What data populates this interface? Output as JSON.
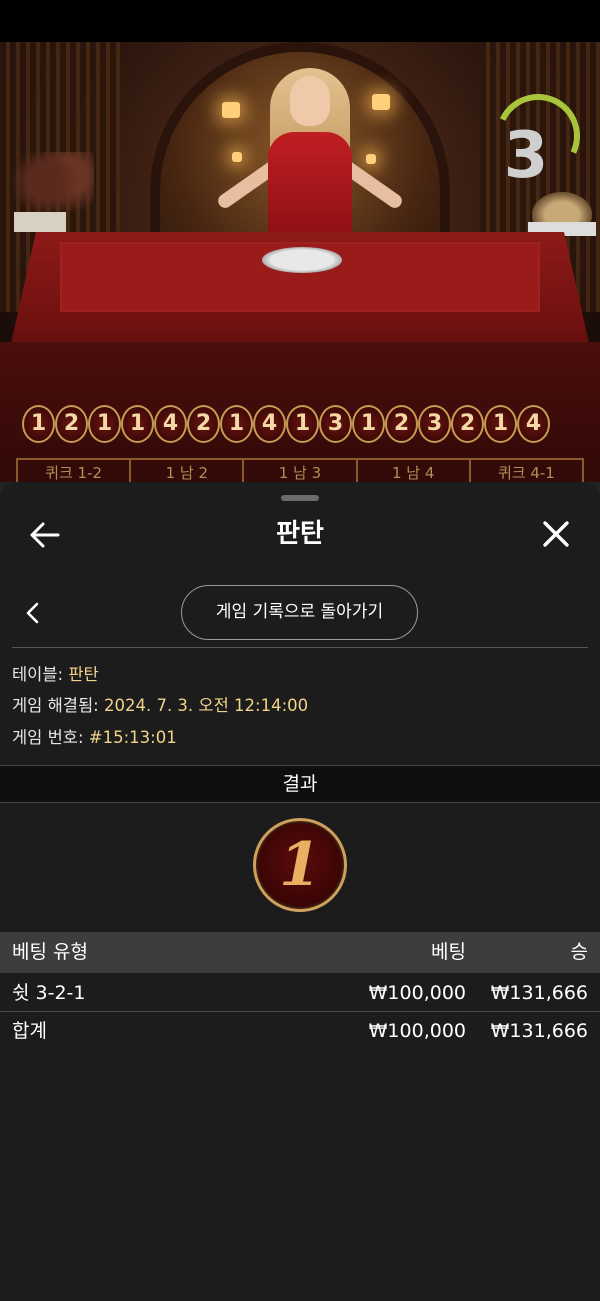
{
  "roadmap": {
    "beads": [
      "1",
      "2",
      "1",
      "1",
      "4",
      "2",
      "1",
      "4",
      "1",
      "3",
      "1",
      "2",
      "3",
      "2",
      "1",
      "4"
    ],
    "betting_labels": [
      "퀴크 1-2",
      "1 남 2",
      "1 남 3",
      "1 남 4",
      "퀴크 4-1"
    ]
  },
  "countdown": "3",
  "sheet": {
    "title": "판탄",
    "back_to_history_label": "게임 기록으로 돌아가기",
    "info": {
      "table_label": "테이블:",
      "table_value": "판탄",
      "resolved_label": "게임 해결됨:",
      "resolved_value": "2024. 7. 3. 오전 12:14:00",
      "game_number_label": "게임 번호:",
      "game_number_value": "#15:13:01"
    },
    "result_header": "결과",
    "result_value": "1",
    "table": {
      "headers": {
        "bet_type": "베팅 유형",
        "bet": "베팅",
        "win": "승"
      },
      "rows": [
        {
          "bet_type": "쉿 3-2-1",
          "bet": "₩100,000",
          "win": "₩131,666"
        }
      ],
      "total": {
        "label": "합계",
        "bet": "₩100,000",
        "win": "₩131,666"
      }
    }
  },
  "colors": {
    "accent_gold": "#f2d38a",
    "bead_border": "#c89a52",
    "sheet_bg": "#1c1c1c",
    "countdown_arc": "#a8c43a"
  }
}
